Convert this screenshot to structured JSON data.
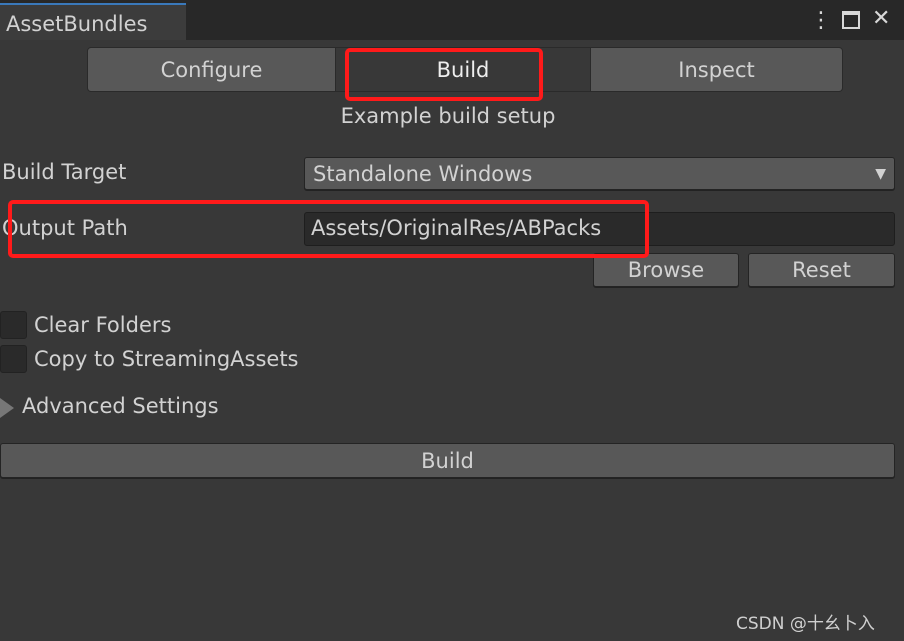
{
  "window": {
    "tab_title": "AssetBundles",
    "icons": [
      "more-vert-icon",
      "maximize-icon",
      "close-icon"
    ]
  },
  "toolbar": {
    "tabs": [
      {
        "label": "Configure",
        "selected": false
      },
      {
        "label": "Build",
        "selected": true
      },
      {
        "label": "Inspect",
        "selected": false
      }
    ]
  },
  "subtitle": "Example build setup",
  "build_target": {
    "label": "Build Target",
    "value": "Standalone Windows"
  },
  "output_path": {
    "label": "Output Path",
    "value": "Assets/OriginalRes/ABPacks",
    "browse_label": "Browse",
    "reset_label": "Reset"
  },
  "options": [
    {
      "label": "Clear Folders",
      "checked": false
    },
    {
      "label": "Copy to StreamingAssets",
      "checked": false
    }
  ],
  "advanced": {
    "label": "Advanced Settings",
    "expanded": false
  },
  "build_button": "Build",
  "watermark": "CSDN @十幺卜入",
  "colors": {
    "background": "#383838",
    "highlight": "#ff1a1a",
    "tab_accent": "#3a79bb"
  }
}
